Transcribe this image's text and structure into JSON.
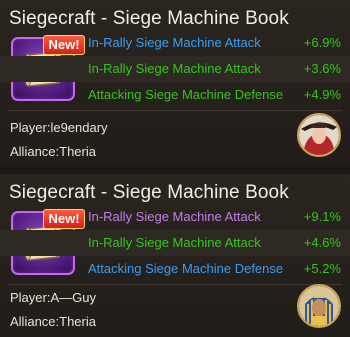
{
  "cards": [
    {
      "title": "Siegecraft - Siege Machine Book",
      "badge": "New!",
      "stats": [
        {
          "name": "In-Rally Siege Machine Attack",
          "value": "+6.9%",
          "name_color": "#3a9ef2"
        },
        {
          "name": "In-Rally Siege Machine Attack",
          "value": "+3.6%",
          "name_color": "#36c51e"
        },
        {
          "name": "Attacking Siege Machine Defense",
          "value": "+4.9%",
          "name_color": "#36c51e"
        }
      ],
      "player": "Player:le9endary",
      "alliance": "Alliance:Theria",
      "avatar_icon": "red-haired-woman-portrait-icon"
    },
    {
      "title": "Siegecraft - Siege Machine Book",
      "badge": "New!",
      "stats": [
        {
          "name": "In-Rally Siege Machine Attack",
          "value": "+9.1%",
          "name_color": "#c47ee8"
        },
        {
          "name": "In-Rally Siege Machine Attack",
          "value": "+4.6%",
          "name_color": "#36c51e"
        },
        {
          "name": "Attacking Siege Machine Defense",
          "value": "+5.2%",
          "name_color": "#3a9ef2"
        }
      ],
      "player": "Player:A—Guy",
      "alliance": "Alliance:Theria",
      "avatar_icon": "pharaoh-portrait-icon"
    }
  ],
  "colors": {
    "value_green": "#36c51e",
    "icon_frame": "#c36ae8",
    "badge_red": "#d3201a"
  }
}
